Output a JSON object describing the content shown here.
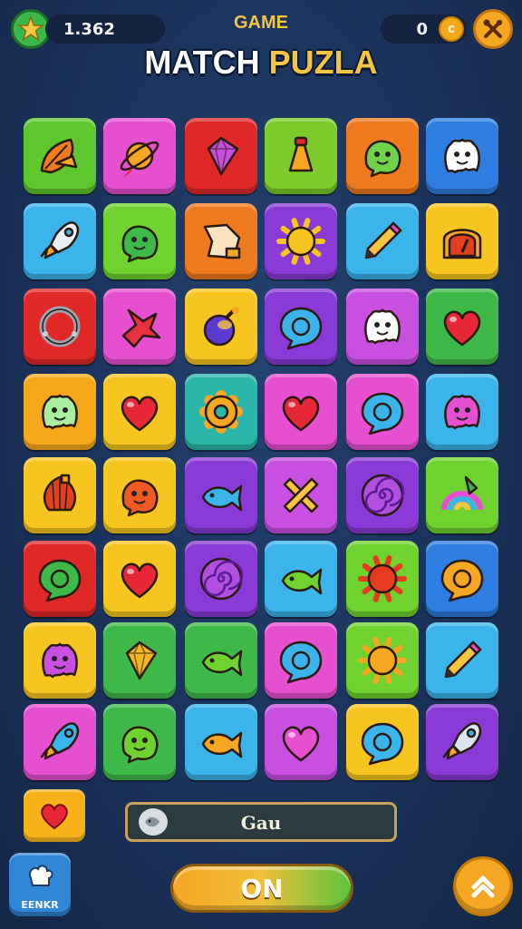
{
  "header": {
    "score": "1.362",
    "title_small": "GAME",
    "title_word1": "MATCH ",
    "title_word2": "PUZLA",
    "coins": "0",
    "coin_symbol": "c"
  },
  "grid": {
    "rows": [
      [
        {
          "bg": "#5ec72e",
          "icon": "leaf-icon",
          "c": "#f07a1e"
        },
        {
          "bg": "#e64fd0",
          "icon": "planet-icon",
          "c": "#f5a623"
        },
        {
          "bg": "#e02828",
          "icon": "gem-icon",
          "c": "#c84fe0"
        },
        {
          "bg": "#7ccb2a",
          "icon": "bottle-icon",
          "c": "#f5a623"
        },
        {
          "bg": "#f07a1e",
          "icon": "slime-icon",
          "c": "#6fd24a"
        },
        {
          "bg": "#2e7de0",
          "icon": "ghost-icon",
          "c": "#ffffff"
        }
      ],
      [
        {
          "bg": "#3ab4ea",
          "icon": "rocket-icon",
          "c": "#e8eef4"
        },
        {
          "bg": "#6fd22e",
          "icon": "slime-icon",
          "c": "#3fb84a"
        },
        {
          "bg": "#f07a1e",
          "icon": "paper-icon",
          "c": "#fbe3c0"
        },
        {
          "bg": "#8a3ad6",
          "icon": "sun-icon",
          "c": "#f7c520"
        },
        {
          "bg": "#3ab4ea",
          "icon": "pencil-icon",
          "c": "#f5c542"
        },
        {
          "bg": "#f7c520",
          "icon": "clock-icon",
          "c": "#e0421e"
        }
      ],
      [
        {
          "bg": "#e02828",
          "icon": "ring-icon",
          "c": "#9aa4ae"
        },
        {
          "bg": "#e64fd0",
          "icon": "bird-icon",
          "c": "#e83040"
        },
        {
          "bg": "#f7c520",
          "icon": "bomb-icon",
          "c": "#5a3ad0"
        },
        {
          "bg": "#8a3ad6",
          "icon": "bubble-icon",
          "c": "#3ab4ea"
        },
        {
          "bg": "#c84fe0",
          "icon": "ghost-icon",
          "c": "#ffffff"
        },
        {
          "bg": "#3fb84a",
          "icon": "heart-icon",
          "c": "#e82838"
        }
      ],
      [
        {
          "bg": "#f7a81a",
          "icon": "ghost-icon",
          "c": "#a8f0a0"
        },
        {
          "bg": "#f7c520",
          "icon": "heart-icon",
          "c": "#e82838"
        },
        {
          "bg": "#2ab6a8",
          "icon": "gear-icon",
          "c": "#f5a623"
        },
        {
          "bg": "#e64fd0",
          "icon": "heart-icon",
          "c": "#e82838"
        },
        {
          "bg": "#e64fd0",
          "icon": "bubble-icon",
          "c": "#3ab4ea"
        },
        {
          "bg": "#3ab4ea",
          "icon": "ghost-icon",
          "c": "#e64fd0"
        }
      ],
      [
        {
          "bg": "#f7c520",
          "icon": "shell-icon",
          "c": "#e0421e"
        },
        {
          "bg": "#f7c520",
          "icon": "slime-icon",
          "c": "#f05a22"
        },
        {
          "bg": "#8a3ad6",
          "icon": "fish-icon",
          "c": "#3ab4ea"
        },
        {
          "bg": "#c84fe0",
          "icon": "cross-icon",
          "c": "#f5c542"
        },
        {
          "bg": "#8a3ad6",
          "icon": "swirl-icon",
          "c": "#b04fe0"
        },
        {
          "bg": "#6fd22e",
          "icon": "rainbow-icon",
          "c": "#e64fd0"
        }
      ],
      [
        {
          "bg": "#e02828",
          "icon": "bubble-icon",
          "c": "#3fb84a"
        },
        {
          "bg": "#f7c520",
          "icon": "heart-icon",
          "c": "#e82838"
        },
        {
          "bg": "#8a3ad6",
          "icon": "swirl-icon",
          "c": "#b04fe0"
        },
        {
          "bg": "#3ab4ea",
          "icon": "fish-icon",
          "c": "#6fd22e"
        },
        {
          "bg": "#6fd22e",
          "icon": "sun-icon",
          "c": "#e83a1e"
        },
        {
          "bg": "#2e7de0",
          "icon": "bubble-icon",
          "c": "#f5a623"
        }
      ],
      [
        {
          "bg": "#f7c520",
          "icon": "ghost-icon",
          "c": "#c84fe0"
        },
        {
          "bg": "#3fb84a",
          "icon": "gem-icon",
          "c": "#f5b520"
        },
        {
          "bg": "#3fb84a",
          "icon": "fish-icon",
          "c": "#6fd22e"
        },
        {
          "bg": "#e64fd0",
          "icon": "bubble-icon",
          "c": "#3ab4ea"
        },
        {
          "bg": "#6fd22e",
          "icon": "sun-icon",
          "c": "#f5a623"
        },
        {
          "bg": "#3ab4ea",
          "icon": "pencil-icon",
          "c": "#f5c542"
        }
      ],
      [
        {
          "bg": "#e64fd0",
          "icon": "rocket-icon",
          "c": "#3ab4ea"
        },
        {
          "bg": "#3fb84a",
          "icon": "slime-icon",
          "c": "#6fd22e"
        },
        {
          "bg": "#3ab4ea",
          "icon": "fish-icon",
          "c": "#f5a623"
        },
        {
          "bg": "#c84fe0",
          "icon": "heart-icon",
          "c": "#e64fd0"
        },
        {
          "bg": "#f7c520",
          "icon": "bubble-icon",
          "c": "#3ab4ea"
        },
        {
          "bg": "#8a3ad6",
          "icon": "rocket-icon",
          "c": "#d8e4ee"
        }
      ]
    ]
  },
  "footer": {
    "status_text": "Gau",
    "menu_label": "EENKR",
    "on_label": "ON"
  },
  "colors": {
    "background": "#1c3562",
    "accent": "#f5a623",
    "green": "#5dc23c"
  }
}
